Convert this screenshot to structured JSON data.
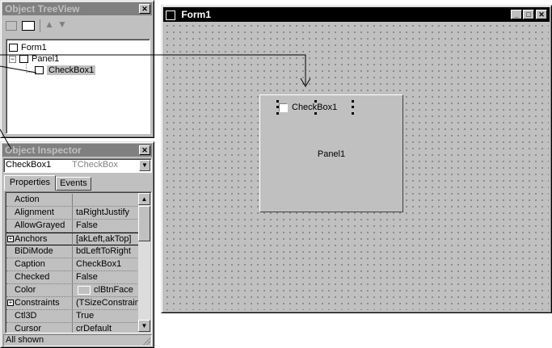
{
  "treeview": {
    "title": "Object TreeView",
    "items": [
      {
        "label": "Form1"
      },
      {
        "label": "Panel1"
      },
      {
        "label": "CheckBox1"
      }
    ]
  },
  "inspector": {
    "title": "Object Inspector",
    "selector_name": "CheckBox1",
    "selector_type": "TCheckBox",
    "tabs": [
      "Properties",
      "Events"
    ],
    "properties": [
      {
        "name": "Action",
        "value": ""
      },
      {
        "name": "Alignment",
        "value": "taRightJustify"
      },
      {
        "name": "AllowGrayed",
        "value": "False"
      },
      {
        "name": "Anchors",
        "value": "[akLeft,akTop]"
      },
      {
        "name": "BiDiMode",
        "value": "bdLeftToRight"
      },
      {
        "name": "Caption",
        "value": "CheckBox1"
      },
      {
        "name": "Checked",
        "value": "False"
      },
      {
        "name": "Color",
        "value": "clBtnFace"
      },
      {
        "name": "Constraints",
        "value": "(TSizeConstraint"
      },
      {
        "name": "Ctl3D",
        "value": "True"
      },
      {
        "name": "Cursor",
        "value": "crDefault"
      }
    ],
    "status": "All shown"
  },
  "form": {
    "title": "Form1",
    "panel_caption": "Panel1",
    "checkbox_caption": "CheckBox1"
  }
}
